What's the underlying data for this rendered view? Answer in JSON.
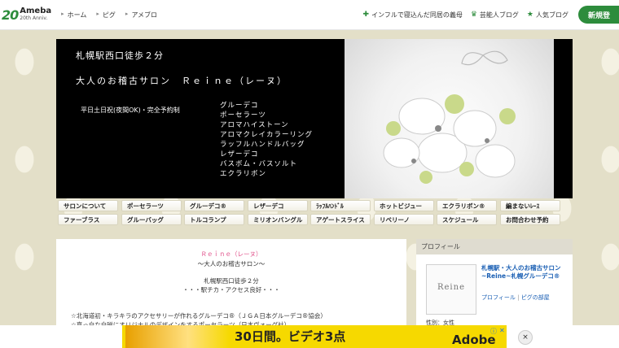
{
  "topbar": {
    "logo_mark": "20",
    "logo_name": "Ameba",
    "logo_sub": "20th Anniv.",
    "nav_left": [
      "ホーム",
      "ピグ",
      "アメブロ"
    ],
    "nav_right": [
      {
        "label": "インフルで寝込んだ同居の義母",
        "icon": "sparkle-icon"
      },
      {
        "label": "芸能人ブログ",
        "icon": "crown-icon"
      },
      {
        "label": "人気ブログ",
        "icon": "star-icon"
      }
    ],
    "register_label": "新規登"
  },
  "header": {
    "line1": "札幌駅西口徒歩２分",
    "line2": "大人のお稽古サロン　Ｒｅｉｎｅ（レーヌ）",
    "line3": "平日土日祝(夜間OK)・完全予約制",
    "menu": [
      "グルーデコ",
      "ポーセラーツ",
      "アロマハイストーン",
      "アロマクレイカラーリング",
      "ラッフルハンドルバッグ",
      "レザーデコ",
      "バスボム・バスソルト",
      "エクラリボン"
    ]
  },
  "nav_buttons": {
    "row1": [
      "サロンについて",
      "ポーセラーツ",
      "グルーデコ®",
      "レザーデコ",
      "ﾗｯﾌﾙﾊﾝﾄﾞﾙ",
      "ホットビジュー",
      "エクラリボン®",
      "編まないﾚｰｽ"
    ],
    "row2": [
      "ファーブラス",
      "グルーバッグ",
      "トルコランプ",
      "ミリオンバングル",
      "アゲートスライス",
      "リベリーノ",
      "スケジュール",
      "お問合わせ予約"
    ]
  },
  "main": {
    "title": "Ｒｅｉｎｅ（レーヌ）",
    "subtitle": "～大人のお稽古サロン～",
    "loc1": "札幌駅西口徒歩２分",
    "loc2": "・・・駅チカ・アクセス良好・・・",
    "p1": "☆北海道初・キラキラのアクセサリーが作れるグルーデコ®（ＪＧＡ日本グルーデコ®協会）",
    "p2": "☆真っ白な白磁にオリジナルのデザインをするポーセラーツ（日本ヴォーグ社）"
  },
  "sidebar": {
    "header": "プロフィール",
    "avatar_text": "Reine",
    "title": "札幌駅・大人のお稽古サロン~Reine~札幌グルーデコ®",
    "link_profile": "プロフィール",
    "link_sep": "|",
    "link_room": "ピグの部屋",
    "gender": "性別：女性"
  },
  "ad": {
    "text": "30日間。ビデオ3点",
    "brand": "Adobe",
    "info": "ⓘ",
    "x": "✕",
    "close": "×"
  },
  "colors": {
    "brand_green": "#2d8c3c",
    "link_blue": "#1a5fb4",
    "ad_yellow": "#f6d900"
  }
}
